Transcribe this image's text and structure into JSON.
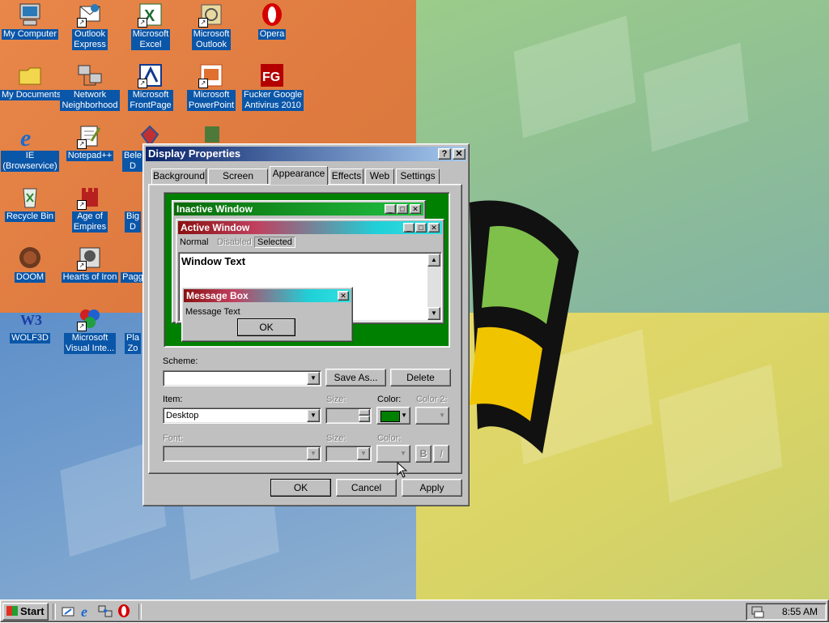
{
  "desktop_icons": [
    {
      "name": "my-computer-icon",
      "label": "My Computer"
    },
    {
      "name": "outlook-express-icon",
      "label": "Outlook\nExpress"
    },
    {
      "name": "excel-icon",
      "label": "Microsoft\nExcel"
    },
    {
      "name": "outlook-icon",
      "label": "Microsoft\nOutlook"
    },
    {
      "name": "opera-icon",
      "label": "Opera"
    },
    {
      "name": "my-documents-icon",
      "label": "My Documents"
    },
    {
      "name": "network-neighborhood-icon",
      "label": "Network\nNeighborhood"
    },
    {
      "name": "frontpage-icon",
      "label": "Microsoft\nFrontPage"
    },
    {
      "name": "powerpoint-icon",
      "label": "Microsoft\nPowerPoint"
    },
    {
      "name": "antivirus-icon",
      "label": "Fucker Google\nAntivirus 2010"
    },
    {
      "name": "ie-icon",
      "label": "IE\n(Browservice)"
    },
    {
      "name": "notepad-plus-icon",
      "label": "Notepad++"
    },
    {
      "name": "bele-icon",
      "label": "Bele\nD"
    },
    {
      "name": "recycle-bin-icon",
      "label": "Recycle Bin"
    },
    {
      "name": "age-of-empires-icon",
      "label": "Age of\nEmpires"
    },
    {
      "name": "big-icon",
      "label": "Big\nD"
    },
    {
      "name": "doom-icon",
      "label": "DOOM"
    },
    {
      "name": "hearts-of-iron-icon",
      "label": "Hearts of Iron"
    },
    {
      "name": "pagg-icon",
      "label": "Pagg"
    },
    {
      "name": "wolf3d-icon",
      "label": "WOLF3D"
    },
    {
      "name": "visual-interdev-icon",
      "label": "Microsoft\nVisual Inte..."
    },
    {
      "name": "pla-icon",
      "label": "Pla\nZo"
    }
  ],
  "dialog": {
    "title": "Display Properties",
    "help_btn": "?",
    "close_btn": "✕",
    "tabs": [
      "Background",
      "Screen Saver",
      "Appearance",
      "Effects",
      "Web",
      "Settings"
    ],
    "selected_tab": "Appearance",
    "preview": {
      "inactive_title": "Inactive Window",
      "active_title": "Active Window",
      "menu_normal": "Normal",
      "menu_disabled": "Disabled",
      "menu_selected": "Selected",
      "window_text": "Window Text",
      "msgbox_title": "Message Box",
      "msgbox_text": "Message Text",
      "msgbox_ok": "OK"
    },
    "scheme_label": "Scheme:",
    "scheme_value": "",
    "save_as": "Save As...",
    "delete": "Delete",
    "item_label": "Item:",
    "item_value": "Desktop",
    "size_label": "Size:",
    "color_label": "Color:",
    "color2_label": "Color 2:",
    "font_label": "Font:",
    "font_size_label": "Size:",
    "font_color_label": "Color:",
    "bold": "B",
    "italic": "I",
    "ok": "OK",
    "cancel": "Cancel",
    "apply": "Apply",
    "desktop_color": "#008000"
  },
  "taskbar": {
    "start_label": "Start",
    "clock": "8:55 AM"
  }
}
